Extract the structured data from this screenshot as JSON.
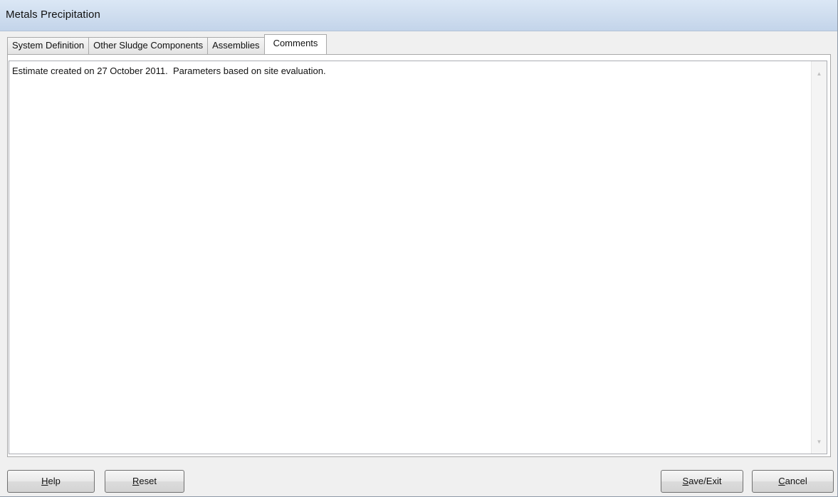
{
  "window": {
    "title": "Metals Precipitation"
  },
  "tabs": [
    {
      "label": "System Definition",
      "active": false
    },
    {
      "label": "Other Sludge Components",
      "active": false
    },
    {
      "label": "Assemblies",
      "active": false
    },
    {
      "label": "Comments",
      "active": true
    }
  ],
  "comments": {
    "text": "Estimate created on 27 October 2011.  Parameters based on site evaluation."
  },
  "buttons": {
    "help": {
      "mnemonic": "H",
      "rest": "elp"
    },
    "reset": {
      "mnemonic": "R",
      "rest": "eset"
    },
    "save": {
      "mnemonic": "S",
      "rest": "ave/Exit"
    },
    "cancel": {
      "mnemonic": "C",
      "rest": "ancel"
    }
  },
  "icons": {
    "scroll_up": "scroll-up-arrow-icon",
    "scroll_down": "scroll-down-arrow-icon"
  }
}
